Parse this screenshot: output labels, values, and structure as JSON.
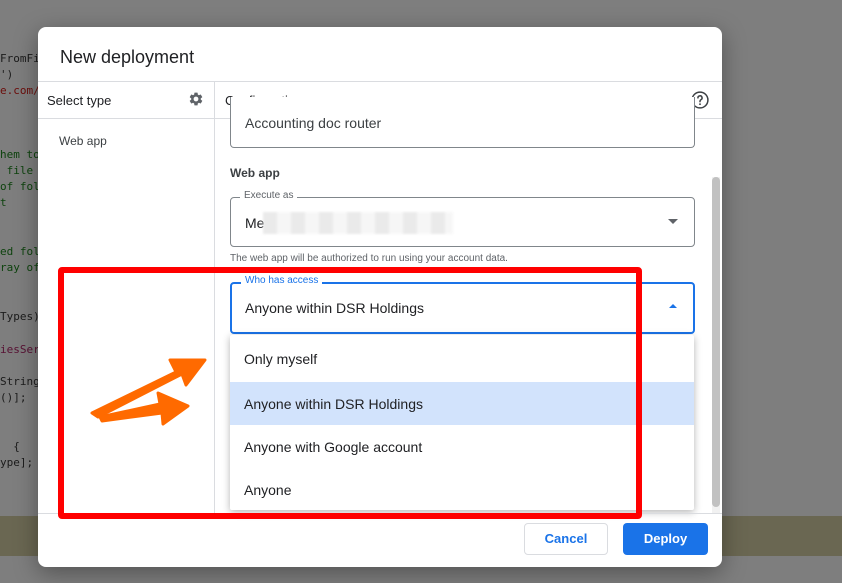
{
  "background": {
    "code_lines": [
      {
        "text": "FromFi",
        "color": "#333333"
      },
      {
        "text": "')",
        "color": "#333333"
      },
      {
        "text": "e.com/",
        "color": "#c41a16"
      },
      {
        "text": "hem to",
        "color": "#1a7a1a"
      },
      {
        "text": " file",
        "color": "#1a7a1a"
      },
      {
        "text": "of fol",
        "color": "#1a7a1a"
      },
      {
        "text": "t",
        "color": "#1a7a1a"
      },
      {
        "text": "ed fol",
        "color": "#1a7a1a"
      },
      {
        "text": "ray of",
        "color": "#1a7a1a"
      },
      {
        "text": "Types)",
        "color": "#333333"
      },
      {
        "text": "iesSer",
        "color": "#a0225f"
      },
      {
        "text": "String",
        "color": "#333333"
      },
      {
        "text": "()];",
        "color": "#333333"
      },
      {
        "text": "  {",
        "color": "#333333"
      },
      {
        "text": "ype];",
        "color": "#333333"
      }
    ]
  },
  "dialog": {
    "title": "New deployment",
    "select_type_label": "Select type",
    "configuration_label": "Configuration",
    "type_items": [
      {
        "label": "Web app"
      }
    ],
    "description_value": "Accounting doc router",
    "web_app_section": "Web app",
    "execute_as": {
      "label": "Execute as",
      "value": "Me"
    },
    "execute_hint": "The web app will be authorized to run using your account data.",
    "who_has_access": {
      "label": "Who has access",
      "value": "Anyone within DSR Holdings",
      "options": [
        {
          "label": "Only myself",
          "selected": false
        },
        {
          "label": "Anyone within DSR Holdings",
          "selected": true
        },
        {
          "label": "Anyone with Google account",
          "selected": false
        },
        {
          "label": "Anyone",
          "selected": false
        }
      ]
    },
    "buttons": {
      "cancel": "Cancel",
      "deploy": "Deploy"
    }
  },
  "icons": {
    "gear": "gear-icon",
    "help": "help-circle-icon",
    "dropdown_closed": "chevron-down-icon",
    "dropdown_open": "chevron-up-icon"
  },
  "colors": {
    "accent": "#1a73e8",
    "selected_option": "#d2e3fc",
    "annotation_red": "#ff0000",
    "annotation_arrow": "#ff6a00"
  }
}
